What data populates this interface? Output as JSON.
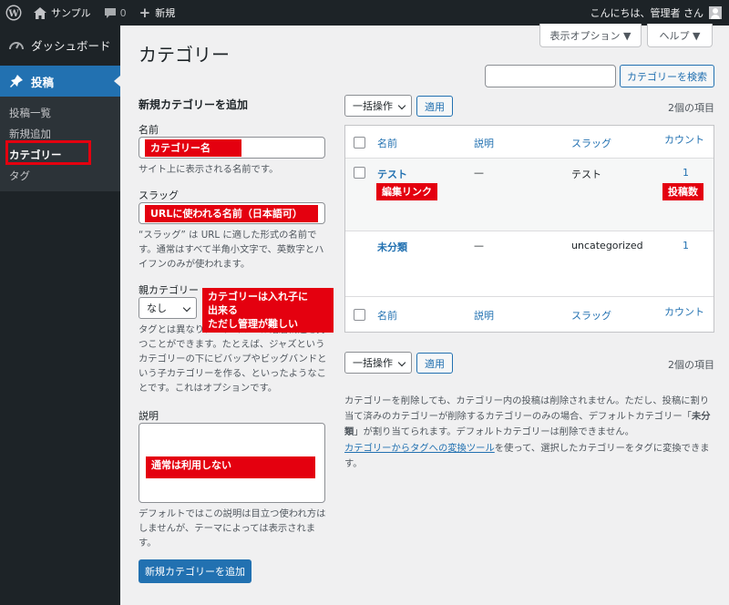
{
  "adminbar": {
    "site_name": "サンプル",
    "comments_count": "0",
    "new_label": "新規",
    "greeting": "こんにちは、管理者 さん"
  },
  "sidebar": {
    "dashboard": "ダッシュボード",
    "posts": "投稿",
    "sub_items": [
      "投稿一覧",
      "新規追加",
      "カテゴリー",
      "タグ"
    ]
  },
  "header": {
    "title": "カテゴリー",
    "screen_options": "表示オプション ▼",
    "help": "ヘルプ ▼",
    "search_button": "カテゴリーを検索",
    "search_value": ""
  },
  "form": {
    "heading": "新規カテゴリーを追加",
    "name_label": "名前",
    "name_help": "サイト上に表示される名前です。",
    "slug_label": "スラッグ",
    "slug_help": "“スラッグ” は URL に適した形式の名前です。通常はすべて半角小文字で、英数字とハイフンのみが使われます。",
    "parent_label": "親カテゴリー",
    "parent_value": "なし",
    "parent_help": "タグとは異なり、カテゴリーは階層構造を持つことができます。たとえば、ジャズというカテゴリーの下にビバップやビッグバンドという子カテゴリーを作る、といったようなことです。これはオプションです。",
    "desc_label": "説明",
    "desc_help": "デフォルトではこの説明は目立つ使われ方はしませんが、テーマによっては表示されます。",
    "submit": "新規カテゴリーを追加"
  },
  "table": {
    "bulk_label": "一括操作",
    "apply_label": "適用",
    "items_count": "2個の項目",
    "columns": [
      "名前",
      "説明",
      "スラッグ",
      "カウント"
    ],
    "rows": [
      {
        "name": "テスト",
        "desc": "—",
        "slug": "テスト",
        "count": "1"
      },
      {
        "name": "未分類",
        "desc": "—",
        "slug": "uncategorized",
        "count": "1"
      }
    ],
    "note_1": "カテゴリーを削除しても、カテゴリー内の投稿は削除されません。ただし、投稿に割り当て済みのカテゴリーが削除するカテゴリーのみの場合、デフォルトカテゴリー「",
    "note_1_bold": "未分類",
    "note_1_end": "」が割り当てられます。デフォルトカテゴリーは削除できません。",
    "note_2_link": "カテゴリーからタグへの変換ツール",
    "note_2_rest": "を使って、選択したカテゴリーをタグに変換できます。"
  },
  "annotations": {
    "name": "カテゴリー名",
    "slug": "URLに使われる名前（日本語可）",
    "parent": [
      "カテゴリーは入れ子に",
      "出来る",
      "ただし管理が難しい"
    ],
    "desc": "通常は利用しない",
    "edit_link": "編集リンク",
    "post_count": "投稿数"
  },
  "colors": {
    "accent": "#2271b1",
    "sidebar": "#1d2327",
    "annotation": "#e4000f"
  }
}
